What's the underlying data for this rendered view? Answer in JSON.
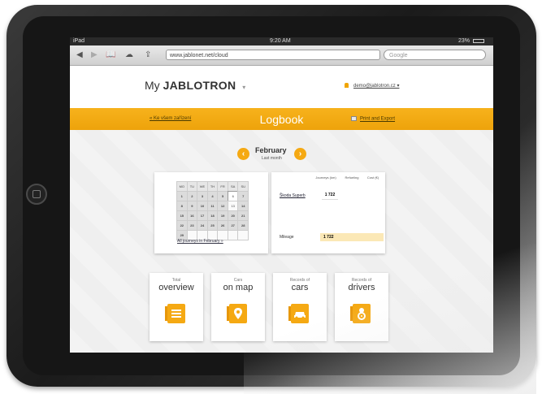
{
  "status": {
    "device": "iPad",
    "time": "9:20 AM",
    "battery": "23%"
  },
  "browser": {
    "url": "www.jablonet.net/cloud",
    "search_placeholder": "Google"
  },
  "app": {
    "logo_my": "My",
    "logo_brand": "JABLOTRON",
    "logo_caret": "▾",
    "user_email": "demo@jablotron.cz ▾"
  },
  "header": {
    "back_link": "« Ke všem zařízení",
    "title": "Logbook",
    "print_link": "Print and Export"
  },
  "month_nav": {
    "prev_icon": "‹",
    "next_icon": "›",
    "month": "February",
    "sub": "Last month"
  },
  "calendar": {
    "weekdays": [
      "MO",
      "TU",
      "WE",
      "TH",
      "FR",
      "SA",
      "SU"
    ],
    "weeks": [
      [
        "1",
        "2",
        "3",
        "4",
        "5",
        "6",
        "7"
      ],
      [
        "8",
        "9",
        "10",
        "11",
        "12",
        "13",
        "14"
      ],
      [
        "15",
        "16",
        "17",
        "18",
        "19",
        "20",
        "21"
      ],
      [
        "22",
        "23",
        "24",
        "25",
        "26",
        "27",
        "28"
      ],
      [
        "29",
        "",
        "",
        "",
        "",
        "",
        ""
      ]
    ],
    "all_link": "All journeys in February »"
  },
  "summary": {
    "columns": [
      "Journeys (km)",
      "Refueling",
      "Cost (€)"
    ],
    "driver_name": "Škoda Superb",
    "driver_km": "1 722",
    "mileage_label": "Mileage",
    "mileage_value": "1 722"
  },
  "tiles": [
    {
      "sup": "Total",
      "title": "overview",
      "icon": "list-icon"
    },
    {
      "sup": "Cars",
      "title": "on map",
      "icon": "map-pin-icon"
    },
    {
      "sup": "Records of",
      "title": "cars",
      "icon": "car-icon"
    },
    {
      "sup": "Records of",
      "title": "drivers",
      "icon": "driver-icon"
    }
  ],
  "colors": {
    "accent": "#f5a913",
    "header_bar": "#f0a60f"
  }
}
